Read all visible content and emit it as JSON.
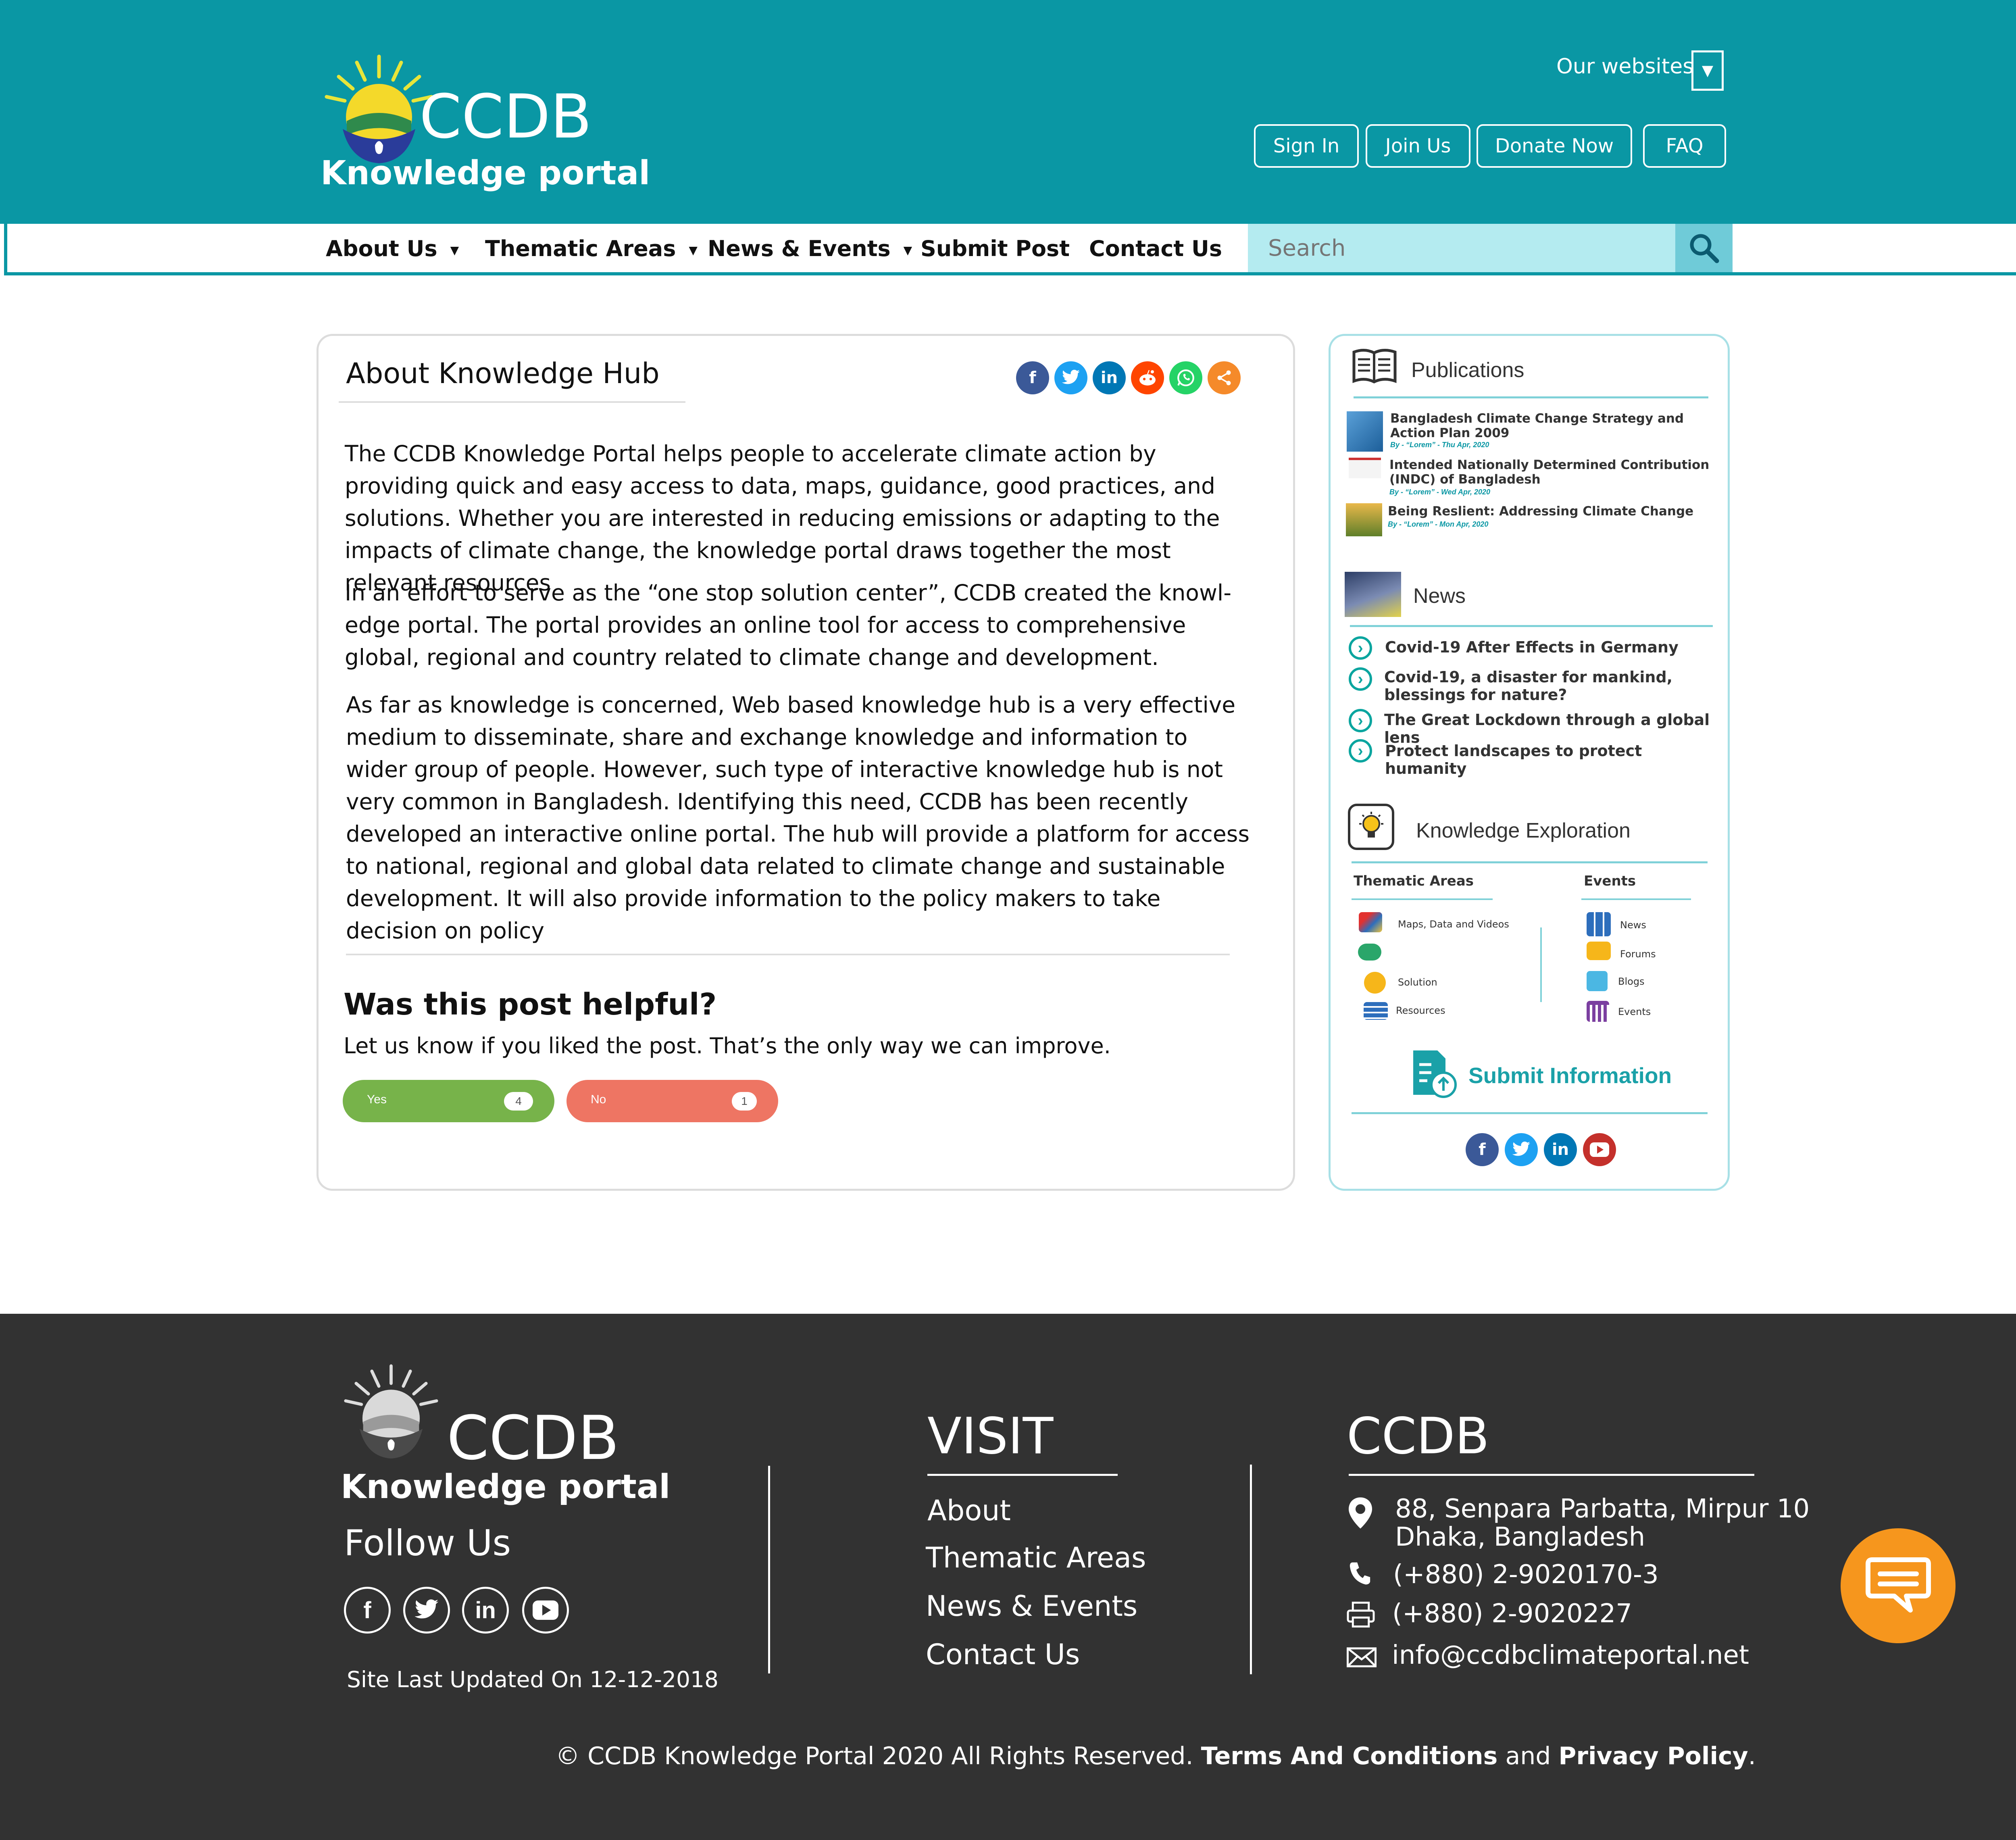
{
  "header": {
    "logo_title": "CCDB",
    "logo_subtitle": "Knowledge portal",
    "our_websites": "Our websites",
    "buttons": [
      "Sign In",
      "Join Us",
      "Donate Now",
      "FAQ"
    ]
  },
  "nav": {
    "items": [
      "About Us",
      "Thematic Areas",
      "News & Events",
      "Submit Post",
      "Contact Us"
    ],
    "search_placeholder": "Search"
  },
  "article": {
    "title": "About Knowledge Hub",
    "share_icons": [
      "facebook-icon",
      "twitter-icon",
      "linkedin-icon",
      "reddit-icon",
      "whatsapp-icon",
      "share-icon"
    ],
    "paragraphs": [
      "The CCDB Knowledge Portal helps people to accelerate climate action by providing quick and easy access to data, maps, guidance, good practices, and solutions. Whether you are interested in reducing emissions or adapting to the impacts of climate change, the knowledge portal draws together the most relevant resources",
      "In an effort to serve as the “one stop solution center”, CCDB created the knowl-edge portal. The portal provides an online tool for access to comprehensive global, regional and country related to climate change and development.",
      "As far as knowledge is concerned, Web based knowledge hub is a very effective medium to disseminate, share and exchange knowledge and information to wider group of people. However, such type of interactive knowledge hub is not very common in Bangladesh. Identifying this need, CCDB has been recently developed an interactive online portal. The hub will provide a platform for access to national, regional and global data related to climate change and sustainable development. It will also provide information to the policy makers to take decision on policy"
    ],
    "feedback_title": "Was this post helpful?",
    "feedback_text": "Let us know if you liked the post. That’s the only way we can improve.",
    "yes_label": "Yes",
    "yes_count": "4",
    "no_label": "No",
    "no_count": "1"
  },
  "sidebar": {
    "publications_title": "Publications",
    "publications": [
      {
        "title": "Bangladesh Climate Change Strategy and Action Plan 2009",
        "by": "By  - “Lorem” - Thu Apr, 2020"
      },
      {
        "title": "Intended Nationally Determined Contribution (INDC) of Bangladesh",
        "by": "By  - “Lorem” - Wed Apr, 2020"
      },
      {
        "title": "Being Reslient: Addressing Climate Change",
        "by": "By  - “Lorem” - Mon Apr, 2020"
      }
    ],
    "news_title": "News",
    "news": [
      "Covid-19 After Effects in Germany",
      "Covid-19, a disaster for mankind, blessings for nature?",
      "The Great Lockdown through a global lens",
      "Protect landscapes to protect humanity"
    ],
    "ke_title": "Knowledge Exploration",
    "ke_thematic_title": "Thematic Areas",
    "ke_thematic": [
      "Maps, Data and Videos",
      "",
      "Solution",
      "Resources"
    ],
    "ke_events_title": "Events",
    "ke_events": [
      "News",
      "Forums",
      "Blogs",
      "Events"
    ],
    "submit_info": "Submit Information"
  },
  "footer": {
    "logo_title": "CCDB",
    "logo_subtitle": "Knowledge portal",
    "follow_us": "Follow Us",
    "site_updated": "Site Last Updated On 12-12-2018",
    "visit_title": "VISIT",
    "visit_links": [
      "About",
      "Thematic Areas",
      "News & Events",
      "Contact Us"
    ],
    "ccdb_title": "CCDB",
    "address_line1": "88, Senpara Parbatta, Mirpur 10",
    "address_line2": "Dhaka, Bangladesh",
    "phone": "(+880) 2-9020170-3",
    "fax": "(+880) 2-9020227",
    "email": "info@ccdbclimateportal.net",
    "copyright_prefix": "© CCDB Knowledge Portal 2020  All Rights Reserved.",
    "terms": "Terms And Conditions",
    "and": "and",
    "privacy": "Privacy Policy",
    "period": "."
  },
  "colors": {
    "teal": "#0a97a4",
    "yes_green": "#77b34a",
    "no_red": "#ee7563",
    "chat_orange": "#f6961d",
    "footer_bg": "#323232"
  }
}
